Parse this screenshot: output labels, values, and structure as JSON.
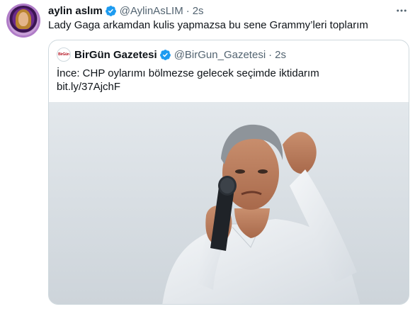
{
  "tweet": {
    "display_name": "aylin aslım",
    "handle": "@AylinAsLIM",
    "separator": "·",
    "time": "2s",
    "text": "Lady Gaga arkamdan kulis yapmazsa bu sene Grammy’leri toplarım"
  },
  "quoted": {
    "display_name": "BirGün Gazetesi",
    "handle": "@BirGun_Gazetesi",
    "separator": "·",
    "time": "2s",
    "text_line1": "İnce: CHP oylarımı bölmezse gelecek seçimde iktidarım",
    "link": "bit.ly/37AjchF",
    "avatar_label": "BirGün"
  },
  "icons": {
    "verified": "verified-badge-icon",
    "more": "more-options-icon"
  },
  "colors": {
    "text": "#0f1419",
    "secondary": "#536471",
    "verified": "#1d9bf0",
    "border": "#cfd9de"
  }
}
